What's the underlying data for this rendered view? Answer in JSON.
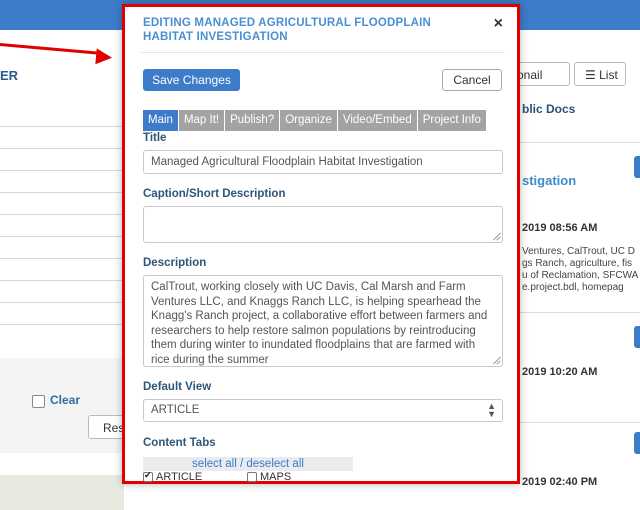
{
  "background_left": {
    "heading_fragment": "ER",
    "clear_label": "Clear",
    "reset_fragment": "Res"
  },
  "background_right": {
    "email_fragment": "onail",
    "list_label": "List",
    "list_icon": "list-icon",
    "public_docs_fragment": "blic Docs",
    "title_fragment": "stigation",
    "date1": "2019 08:56 AM",
    "snippet_lines": [
      "Ventures, CalTrout, UC D",
      "gs Ranch, agriculture, fis",
      "u of Reclamation, SFCWA",
      "e.project.bdl, homepag"
    ],
    "date2": "2019 10:20 AM",
    "date3": "2019 02:40 PM"
  },
  "modal": {
    "title": "EDITING MANAGED AGRICULTURAL FLOODPLAIN HABITAT INVESTIGATION",
    "close_icon": "×",
    "save_label": "Save Changes",
    "cancel_label": "Cancel",
    "tabs": [
      "Main",
      "Map It!",
      "Publish?",
      "Organize",
      "Video/Embed",
      "Project Info"
    ],
    "active_tab": "Main",
    "title_label": "Title",
    "title_value": "Managed Agricultural Floodplain Habitat Investigation",
    "caption_label": "Caption/Short Description",
    "caption_value": "",
    "description_label": "Description",
    "description_value": "CalTrout, working closely with UC Davis, Cal Marsh and Farm Ventures LLC, and Knaggs Ranch LLC, is helping spearhead the Knagg's Ranch project, a collaborative effort between farmers and researchers to help restore salmon populations by reintroducing them during winter to inundated floodplains that are farmed with rice during the summer",
    "default_view_label": "Default View",
    "default_view_value": "ARTICLE",
    "content_tabs_label": "Content Tabs",
    "select_all": "select all",
    "separator": " / ",
    "deselect_all": "deselect all",
    "checkboxes": [
      {
        "label": "ARTICLE",
        "checked": true
      },
      {
        "label": "MAPS",
        "checked": false
      }
    ]
  },
  "colors": {
    "accent": "#3d7cc9",
    "highlight_border": "#e00000",
    "tab_inactive": "#a3a3a3"
  }
}
